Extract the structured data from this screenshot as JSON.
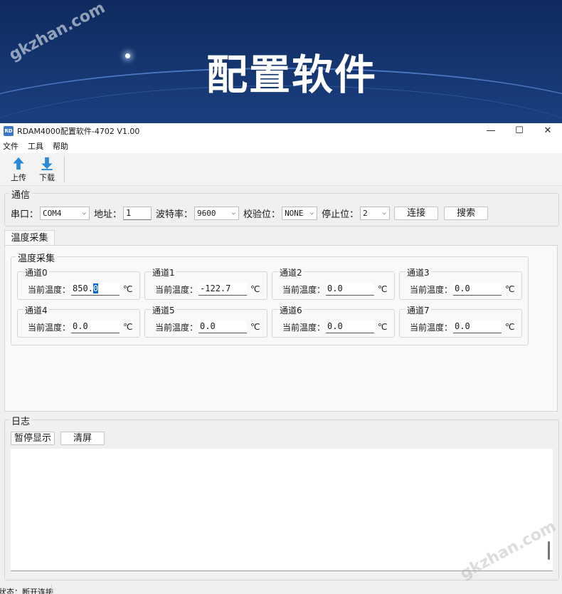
{
  "banner": {
    "title": "配置软件",
    "watermark": "gkzhan.com"
  },
  "window": {
    "title": "RDAM4000配置软件-4702 V1.00",
    "icon_text": "RD",
    "controls": {
      "minimize": "—",
      "maximize": "☐",
      "close": "✕"
    }
  },
  "menu": [
    "文件",
    "工具",
    "帮助"
  ],
  "toolbar": {
    "upload_label": "上传",
    "download_label": "下载",
    "upload_icon": "arrow-up-icon",
    "download_icon": "arrow-down-icon",
    "icon_color": "#2b8ad8"
  },
  "comm": {
    "title": "通信",
    "port_label": "串口：",
    "port_value": "COM4",
    "address_label": "地址：",
    "address_value": "1",
    "baud_label": "波特率：",
    "baud_value": "9600",
    "parity_label": "校验位：",
    "parity_value": "NONE",
    "stopbit_label": "停止位：",
    "stopbit_value": "2",
    "connect_label": "连接",
    "search_label": "搜索"
  },
  "tab": {
    "label": "温度采集"
  },
  "temperature": {
    "group_title": "温度采集",
    "field_label": "当前温度：",
    "unit": "℃",
    "channels": [
      {
        "name": "通道0",
        "value_pre": "850.",
        "value_sel": "0"
      },
      {
        "name": "通道1",
        "value_pre": "-122.7",
        "value_sel": ""
      },
      {
        "name": "通道2",
        "value_pre": "0.0",
        "value_sel": ""
      },
      {
        "name": "通道3",
        "value_pre": "0.0",
        "value_sel": ""
      },
      {
        "name": "通道4",
        "value_pre": "0.0",
        "value_sel": ""
      },
      {
        "name": "通道5",
        "value_pre": "0.0",
        "value_sel": ""
      },
      {
        "name": "通道6",
        "value_pre": "0.0",
        "value_sel": ""
      },
      {
        "name": "通道7",
        "value_pre": "0.0",
        "value_sel": ""
      }
    ]
  },
  "log": {
    "title": "日志",
    "pause_label": "暂停显示",
    "clear_label": "清屏"
  },
  "status": {
    "text": "状态：断开连接"
  },
  "colors": {
    "banner_bg": "#153670",
    "selection": "#0a64d8"
  }
}
